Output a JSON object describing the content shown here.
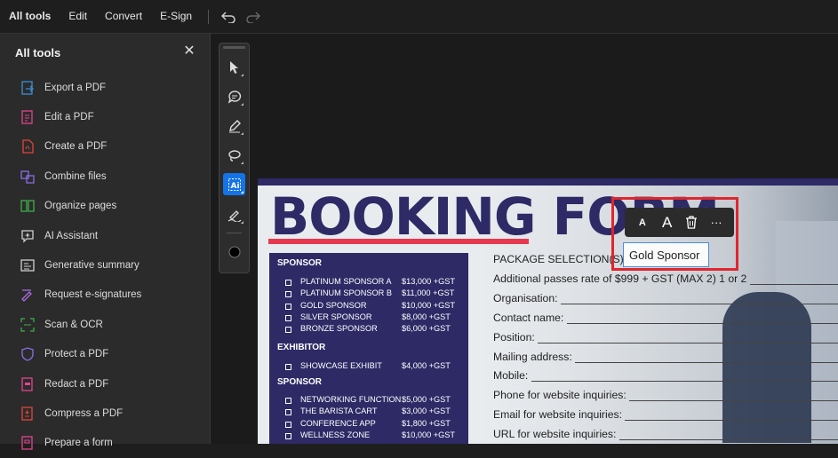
{
  "menubar": {
    "items": [
      {
        "label": "All tools",
        "active": true
      },
      {
        "label": "Edit"
      },
      {
        "label": "Convert"
      },
      {
        "label": "E-Sign"
      }
    ],
    "undo_icon": "undo-icon",
    "redo_icon": "redo-icon"
  },
  "sidebar": {
    "title": "All tools",
    "close_icon": "close-icon",
    "items": [
      {
        "label": "Export a PDF",
        "icon": "export-pdf-icon",
        "color": "#3b8fd9"
      },
      {
        "label": "Edit a PDF",
        "icon": "edit-pdf-icon",
        "color": "#e0448f"
      },
      {
        "label": "Create a PDF",
        "icon": "create-pdf-icon",
        "color": "#e2453c"
      },
      {
        "label": "Combine files",
        "icon": "combine-files-icon",
        "color": "#8b6de0"
      },
      {
        "label": "Organize pages",
        "icon": "organize-pages-icon",
        "color": "#3fae4a"
      },
      {
        "label": "AI Assistant",
        "icon": "ai-assistant-icon",
        "color": "#cfcfcf"
      },
      {
        "label": "Generative summary",
        "icon": "generative-summary-icon",
        "color": "#cfcfcf"
      },
      {
        "label": "Request e-signatures",
        "icon": "request-esignature-icon",
        "color": "#a86be0"
      },
      {
        "label": "Scan & OCR",
        "icon": "scan-ocr-icon",
        "color": "#3fae4a"
      },
      {
        "label": "Protect a PDF",
        "icon": "protect-pdf-icon",
        "color": "#8b6de0"
      },
      {
        "label": "Redact a PDF",
        "icon": "redact-pdf-icon",
        "color": "#e0448f"
      },
      {
        "label": "Compress a PDF",
        "icon": "compress-pdf-icon",
        "color": "#e2453c"
      },
      {
        "label": "Prepare a form",
        "icon": "prepare-form-icon",
        "color": "#e0448f"
      }
    ]
  },
  "vtoolbar": {
    "tools": [
      {
        "name": "select-icon"
      },
      {
        "name": "comment-icon"
      },
      {
        "name": "highlight-pen-icon"
      },
      {
        "name": "lasso-icon"
      },
      {
        "name": "edit-text-icon",
        "selected": true
      },
      {
        "name": "sign-icon"
      },
      {
        "name": "color-dot-icon"
      }
    ],
    "selected_color": "#0073e6"
  },
  "document": {
    "title": "BOOKING FORM",
    "sponsor_box": {
      "sponsor_heading": "SPONSOR",
      "sponsor_rows": [
        {
          "name": "PLATINUM SPONSOR A",
          "price": "$13,000 +GST"
        },
        {
          "name": "PLATINUM SPONSOR B",
          "price": "$11,000 +GST"
        },
        {
          "name": "GOLD SPONSOR",
          "price": "$10,000 +GST"
        },
        {
          "name": "SILVER SPONSOR",
          "price": "$8,000 +GST"
        },
        {
          "name": "BRONZE SPONSOR",
          "price": "$6,000 +GST"
        }
      ],
      "exhibitor_heading": "EXHIBITOR",
      "exhibitor_rows": [
        {
          "name": "SHOWCASE EXHIBIT",
          "price": "$4,000 +GST"
        }
      ],
      "sponsor2_heading": "SPONSOR",
      "sponsor2_rows": [
        {
          "name": "NETWORKING FUNCTION",
          "price": "$5,000 +GST"
        },
        {
          "name": "THE BARISTA CART",
          "price": "$3,000 +GST"
        },
        {
          "name": "CONFERENCE APP",
          "price": "$1,800 +GST"
        },
        {
          "name": "WELLNESS ZONE",
          "price": "$10,000 +GST"
        }
      ]
    },
    "form_lines": [
      "PACKAGE SELECTION(S)",
      "Additional passes rate of $999 + GST (MAX 2) 1 or 2",
      "Organisation:",
      "Contact name:",
      "Position:",
      "Mailing address:",
      "Mobile:",
      "Phone for website inquiries:",
      "Email for website inquiries:",
      "URL for website inquiries:"
    ],
    "edited_text": "Gold Sponsor"
  },
  "float_toolbar": {
    "items": [
      "decrease-font-size-icon",
      "increase-font-size-icon",
      "delete-icon",
      "more-options-icon"
    ],
    "small_a": "A",
    "large_a": "A",
    "more": "···"
  },
  "colors": {
    "accent": "#1473e6",
    "highlight": "#e0262e",
    "brand_navy": "#2d2a66",
    "brand_red": "#e63950"
  }
}
